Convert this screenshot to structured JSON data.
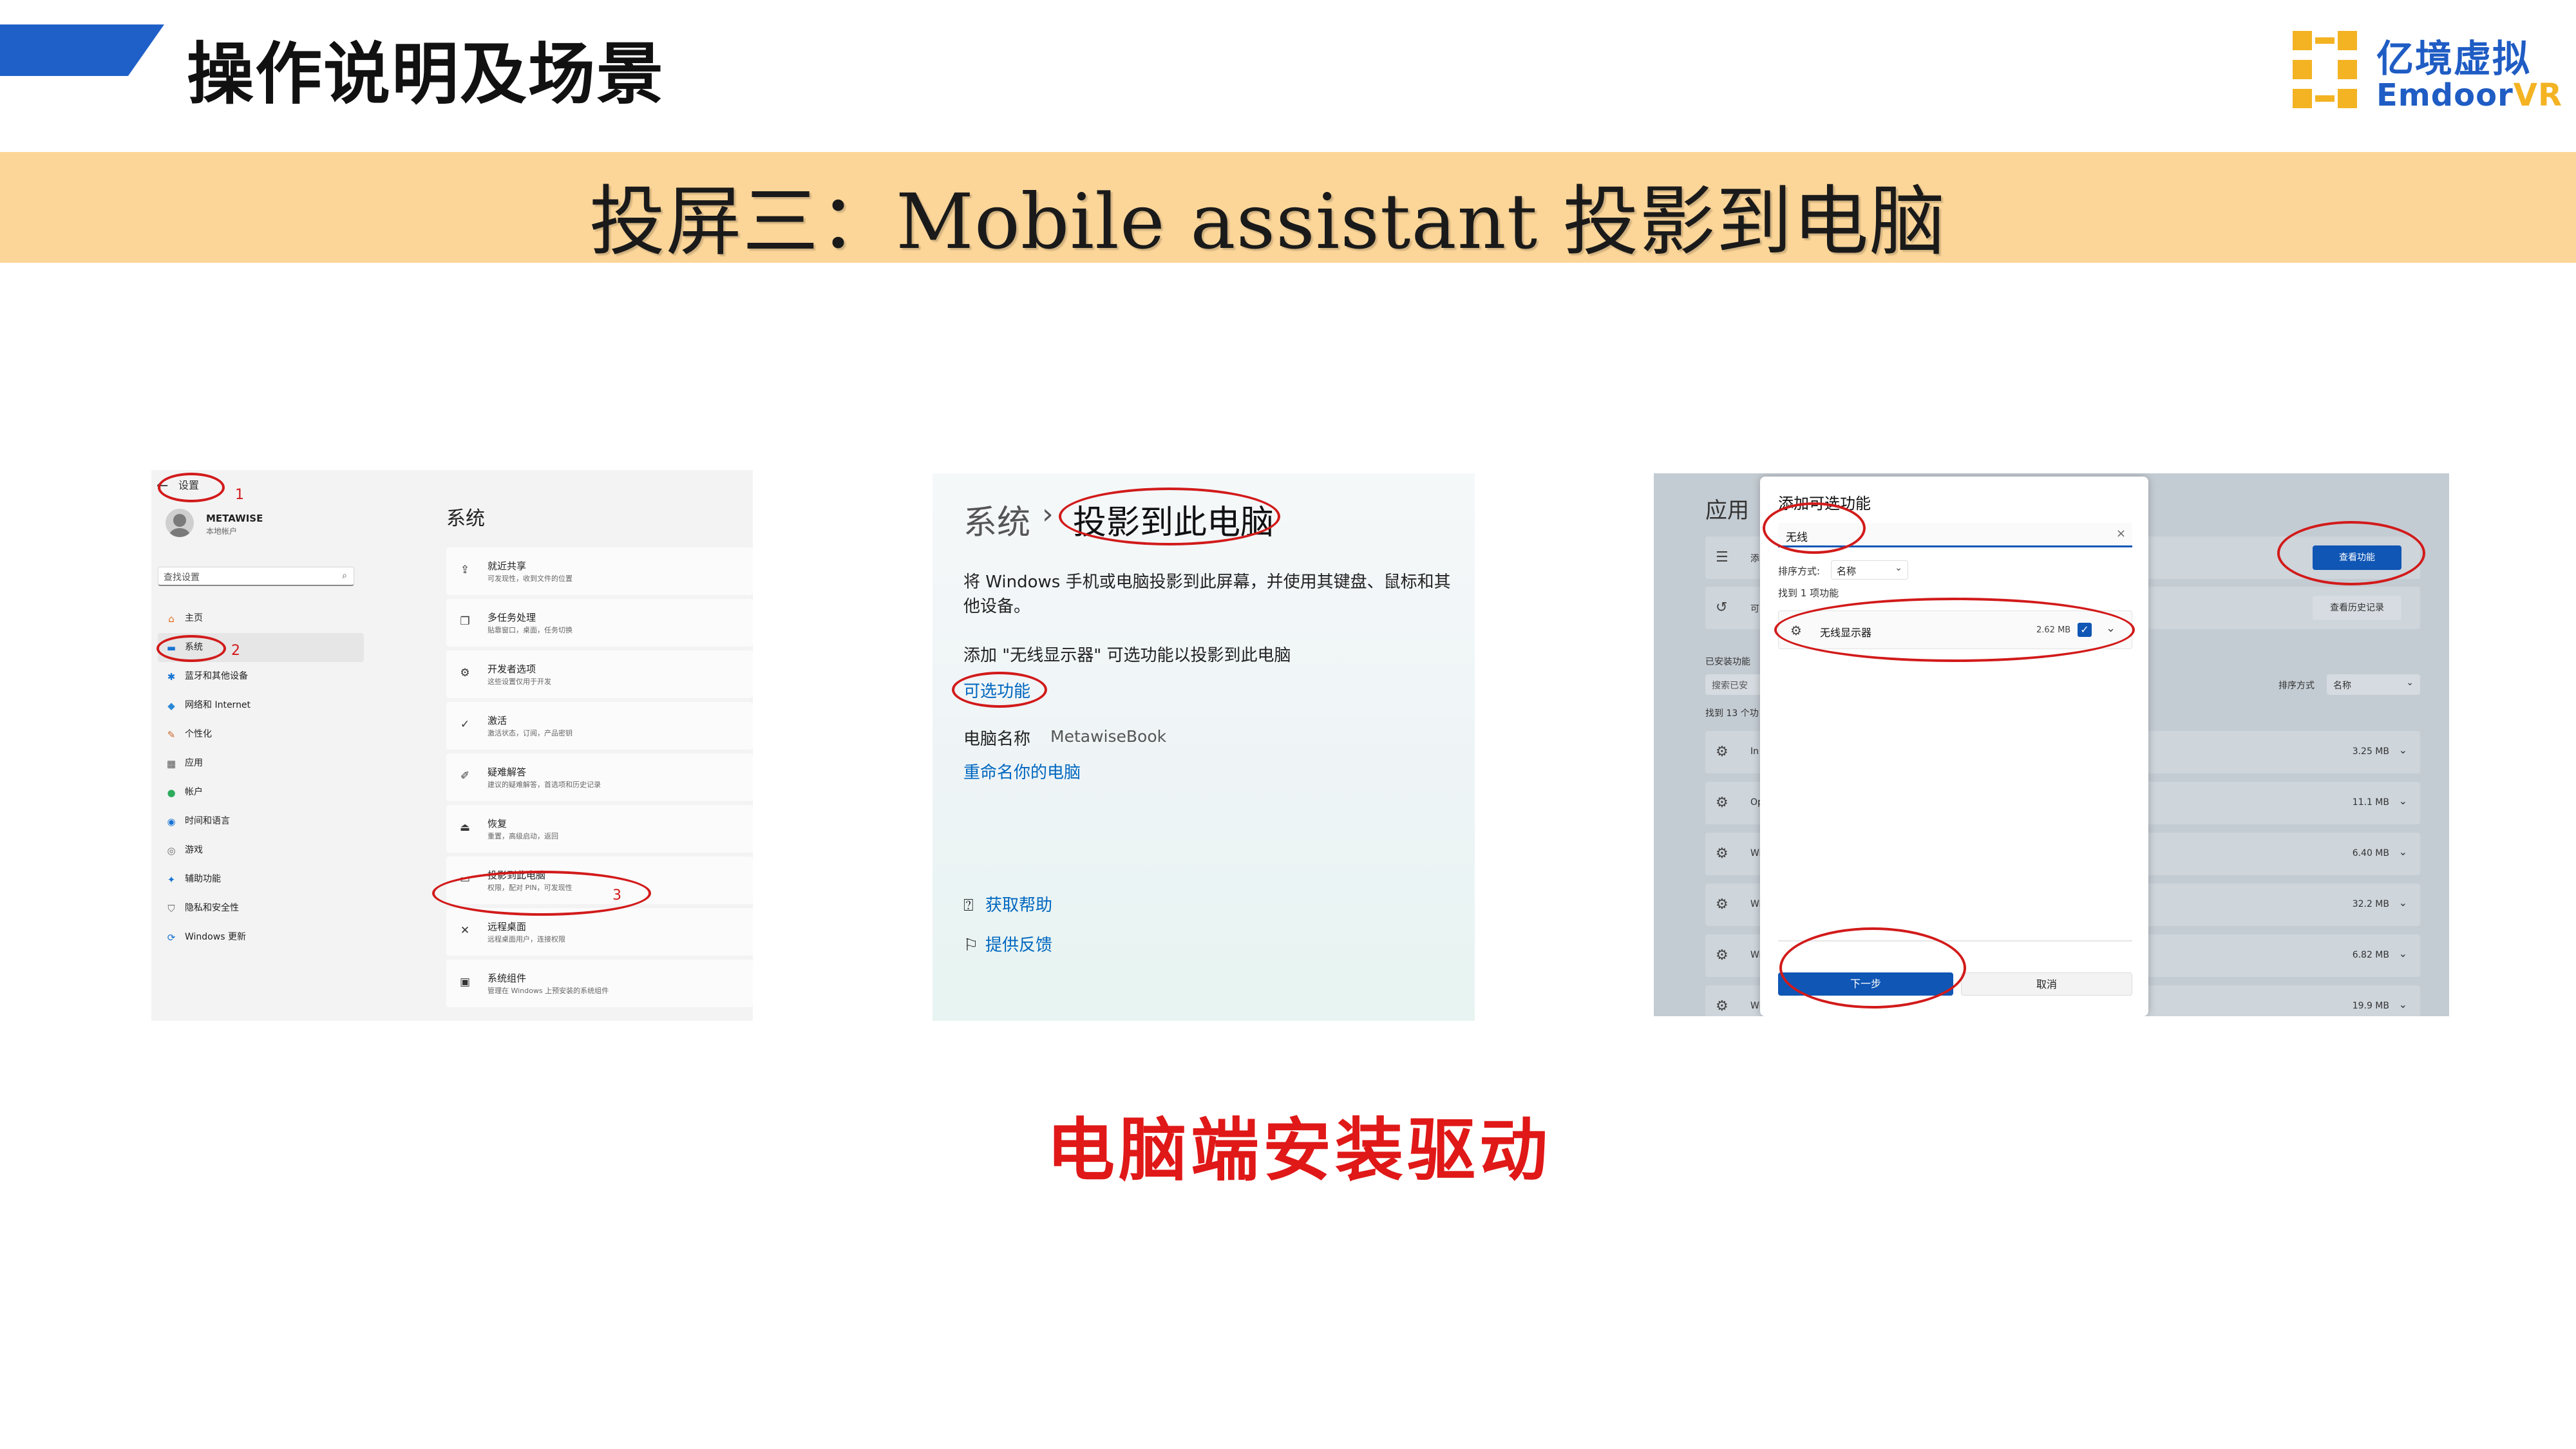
{
  "header": {
    "title": "操作说明及场景",
    "logo_cn": "亿境虚拟",
    "logo_en_main": "Emdoor",
    "logo_en_accent": "VR",
    "accent_color": "#1f60c8",
    "logo_color": "#f3b323"
  },
  "banner": {
    "text": "投屏三：Mobile assistant 投影到电脑",
    "background": "#fcd699"
  },
  "caption": {
    "text": "电脑端安装驱动",
    "color": "#e01818"
  },
  "panel1": {
    "back_icon": "arrow-left-icon",
    "settings_label": "设置",
    "annotation_1": "1",
    "annotation_2": "2",
    "annotation_3": "3",
    "user_name": "METAWISE",
    "user_sub": "本地帐户",
    "search_placeholder": "查找设置",
    "nav": [
      {
        "label": "主页",
        "icon": "home-icon",
        "icon_char": "⌂",
        "icon_color": "#e46b1e"
      },
      {
        "label": "系统",
        "icon": "monitor-icon",
        "icon_char": "▬",
        "icon_color": "#1773d3",
        "active": true
      },
      {
        "label": "蓝牙和其他设备",
        "icon": "bluetooth-icon",
        "icon_char": "✱",
        "icon_color": "#1773d3"
      },
      {
        "label": "网络和 Internet",
        "icon": "wifi-icon",
        "icon_char": "◆",
        "icon_color": "#2a88d8"
      },
      {
        "label": "个性化",
        "icon": "brush-icon",
        "icon_char": "✎",
        "icon_color": "#c9672b"
      },
      {
        "label": "应用",
        "icon": "apps-icon",
        "icon_char": "▦",
        "icon_color": "#555"
      },
      {
        "label": "帐户",
        "icon": "account-icon",
        "icon_char": "●",
        "icon_color": "#2cac5c"
      },
      {
        "label": "时间和语言",
        "icon": "globe-icon",
        "icon_char": "◉",
        "icon_color": "#1773d3"
      },
      {
        "label": "游戏",
        "icon": "gamepad-icon",
        "icon_char": "◎",
        "icon_color": "#666"
      },
      {
        "label": "辅助功能",
        "icon": "accessibility-icon",
        "icon_char": "✦",
        "icon_color": "#1773d3"
      },
      {
        "label": "隐私和安全性",
        "icon": "shield-icon",
        "icon_char": "⛉",
        "icon_color": "#666"
      },
      {
        "label": "Windows 更新",
        "icon": "update-icon",
        "icon_char": "⟳",
        "icon_color": "#1773d3"
      }
    ],
    "main_title": "系统",
    "cards": [
      {
        "title": "就近共享",
        "sub": "可发现性，收到文件的位置",
        "icon": "share-icon",
        "icon_char": "⇪"
      },
      {
        "title": "多任务处理",
        "sub": "贴靠窗口，桌面，任务切换",
        "icon": "multitask-icon",
        "icon_char": "❐"
      },
      {
        "title": "开发者选项",
        "sub": "这些设置仅用于开发",
        "icon": "developer-icon",
        "icon_char": "⚙"
      },
      {
        "title": "激活",
        "sub": "激活状态，订阅，产品密钥",
        "icon": "check-circle-icon",
        "icon_char": "✓"
      },
      {
        "title": "疑难解答",
        "sub": "建议的疑难解答，首选项和历史记录",
        "icon": "wrench-icon",
        "icon_char": "✐"
      },
      {
        "title": "恢复",
        "sub": "重置，高级启动，返回",
        "icon": "recovery-icon",
        "icon_char": "⏏"
      },
      {
        "title": "投影到此电脑",
        "sub": "权限，配对 PIN，可发现性",
        "icon": "projection-icon",
        "icon_char": "▭"
      },
      {
        "title": "远程桌面",
        "sub": "远程桌面用户，连接权限",
        "icon": "remote-desktop-icon",
        "icon_char": "✕"
      },
      {
        "title": "系统组件",
        "sub": "管理在 Windows 上预安装的系统组件",
        "icon": "components-icon",
        "icon_char": "▣"
      }
    ]
  },
  "panel2": {
    "breadcrumb_parent": "系统",
    "breadcrumb_sep": "›",
    "breadcrumb_current": "投影到此电脑",
    "description": "将 Windows 手机或电脑投影到此屏幕，并使用其键盘、鼠标和其他设备。",
    "add_text": "添加 \"无线显示器\" 可选功能以投影到此电脑",
    "optional_link": "可选功能",
    "pc_name_label": "电脑名称",
    "pc_name_value": "MetawiseBook",
    "rename_link": "重命名你的电脑",
    "help_icon": "help-icon",
    "help_link": "获取帮助",
    "feedback_icon": "feedback-icon",
    "feedback_link": "提供反馈"
  },
  "panel3": {
    "bg_title": "应用",
    "bg_rows_top": [
      {
        "label": "添",
        "icon": "list-icon",
        "icon_char": "☰"
      },
      {
        "label": "可",
        "icon": "history-icon",
        "icon_char": "↺"
      }
    ],
    "view_features_btn": "查看功能",
    "view_history_btn": "查看历史记录",
    "installed_label": "已安装功能",
    "search_installed": "搜索已安",
    "sort_label": "排序方式",
    "sort_value": "名称",
    "found_label": "找到 13 个功",
    "bg_list": [
      {
        "label": "In",
        "size": "3.25 MB"
      },
      {
        "label": "Op",
        "size": "11.1 MB"
      },
      {
        "label": "Wi",
        "size": "6.40 MB"
      },
      {
        "label": "Wi",
        "size": "32.2 MB"
      },
      {
        "label": "Wi",
        "size": "6.82 MB"
      },
      {
        "label": "Wi",
        "size": "19.9 MB"
      }
    ],
    "dialog": {
      "title": "添加可选功能",
      "search_value": "无线",
      "clear_icon": "×",
      "sort_label": "排序方式:",
      "sort_value": "名称",
      "found": "找到 1 项功能",
      "item_name": "无线显示器",
      "item_size": "2.62 MB",
      "checkbox_mark": "✓",
      "next_btn": "下一步",
      "cancel_btn": "取消"
    }
  }
}
